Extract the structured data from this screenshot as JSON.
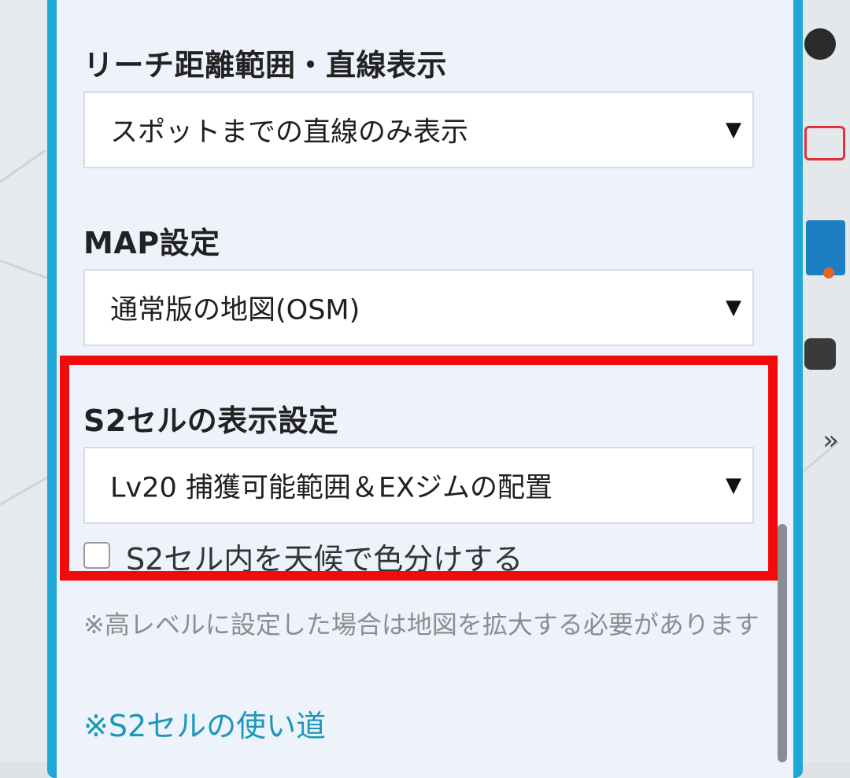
{
  "settings": {
    "reach": {
      "title": "リーチ距離範囲・直線表示",
      "value": "スポットまでの直線のみ表示"
    },
    "map": {
      "title": "MAP設定",
      "value": "通常版の地図(OSM)"
    },
    "s2": {
      "title": "S2セルの表示設定",
      "value": "Lv20 捕獲可能範囲＆EXジムの配置",
      "checkbox_label": "S2セル内を天候で色分けする",
      "checkbox_checked": false
    },
    "note": "※高レベルに設定した場合は地図を拡大する必要があります",
    "link": "※S2セルの使い道"
  },
  "icons": {
    "dropdown_arrow": "▼"
  },
  "colors": {
    "panel_border": "#1fa8d6",
    "panel_bg": "#eef3fb",
    "highlight": "#f10b0b",
    "link": "#1b97ba"
  }
}
